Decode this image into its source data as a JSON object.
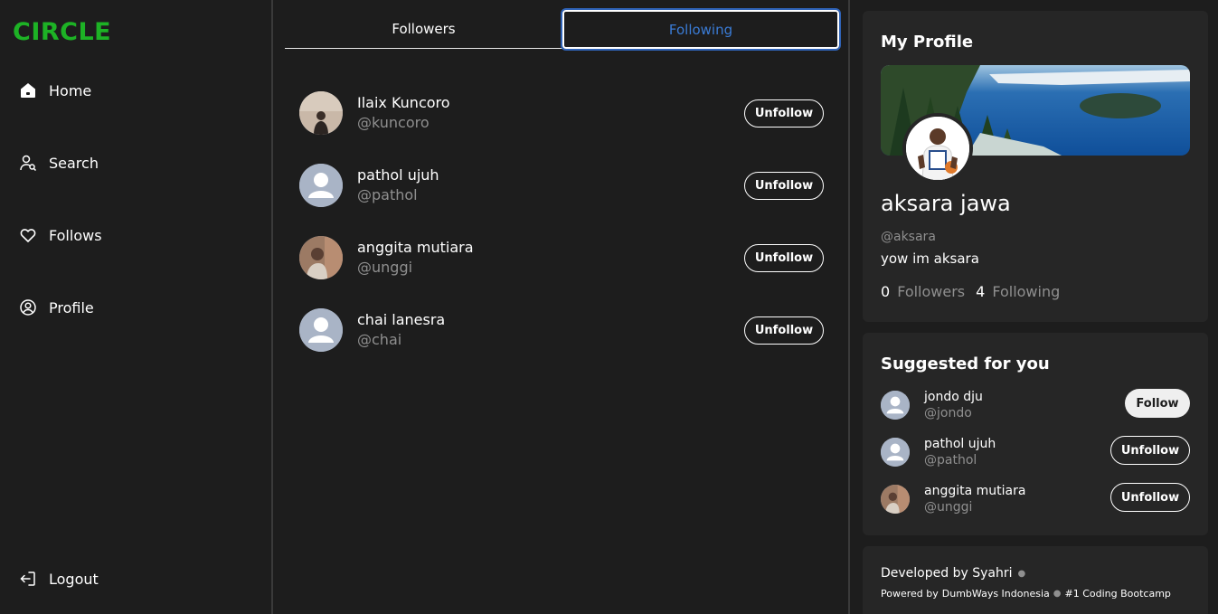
{
  "sidebar": {
    "brand": "CIRCLE",
    "brand_color": "#1db225",
    "nav": [
      {
        "label": "Home",
        "icon": "home-icon"
      },
      {
        "label": "Search",
        "icon": "search-user-icon"
      },
      {
        "label": "Follows",
        "icon": "heart-icon"
      },
      {
        "label": "Profile",
        "icon": "user-circle-icon"
      }
    ],
    "logout": {
      "label": "Logout",
      "icon": "logout-icon"
    }
  },
  "center": {
    "tabs": [
      {
        "label": "Followers",
        "active": false
      },
      {
        "label": "Following",
        "active": true
      }
    ],
    "list": [
      {
        "name": "Ilaix Kuncoro",
        "handle": "@kuncoro",
        "avatar": "photo-avatar",
        "action": "Unfollow"
      },
      {
        "name": "pathol ujuh",
        "handle": "@pathol",
        "avatar": "default-avatar",
        "action": "Unfollow"
      },
      {
        "name": "anggita mutiara",
        "handle": "@unggi",
        "avatar": "photo-avatar",
        "action": "Unfollow"
      },
      {
        "name": "chai lanesra",
        "handle": "@chai",
        "avatar": "default-avatar",
        "action": "Unfollow"
      }
    ]
  },
  "right": {
    "profile": {
      "title": "My Profile",
      "name": "aksara jawa",
      "handle": "@aksara",
      "bio": "yow im aksara",
      "followers_count": "0",
      "followers_label": "Followers",
      "following_count": "4",
      "following_label": "Following"
    },
    "suggested": {
      "title": "Suggested for you",
      "items": [
        {
          "name": "jondo dju",
          "handle": "@jondo",
          "avatar": "default-avatar",
          "action": "Follow"
        },
        {
          "name": "pathol ujuh",
          "handle": "@pathol",
          "avatar": "default-avatar",
          "action": "Unfollow"
        },
        {
          "name": "anggita mutiara",
          "handle": "@unggi",
          "avatar": "photo-avatar",
          "action": "Unfollow"
        }
      ]
    },
    "footer": {
      "developed_by": "Developed by Syahri",
      "powered_by_label": "Powered by",
      "powered_by_name": "DumbWays Indonesia",
      "tagline": "#1 Coding Bootcamp"
    }
  },
  "colors": {
    "background": "#1d1d1d",
    "card": "#262626",
    "accent_green": "#1db225",
    "tab_active": "#3a7bd5",
    "muted_text": "#8f8f8f"
  }
}
